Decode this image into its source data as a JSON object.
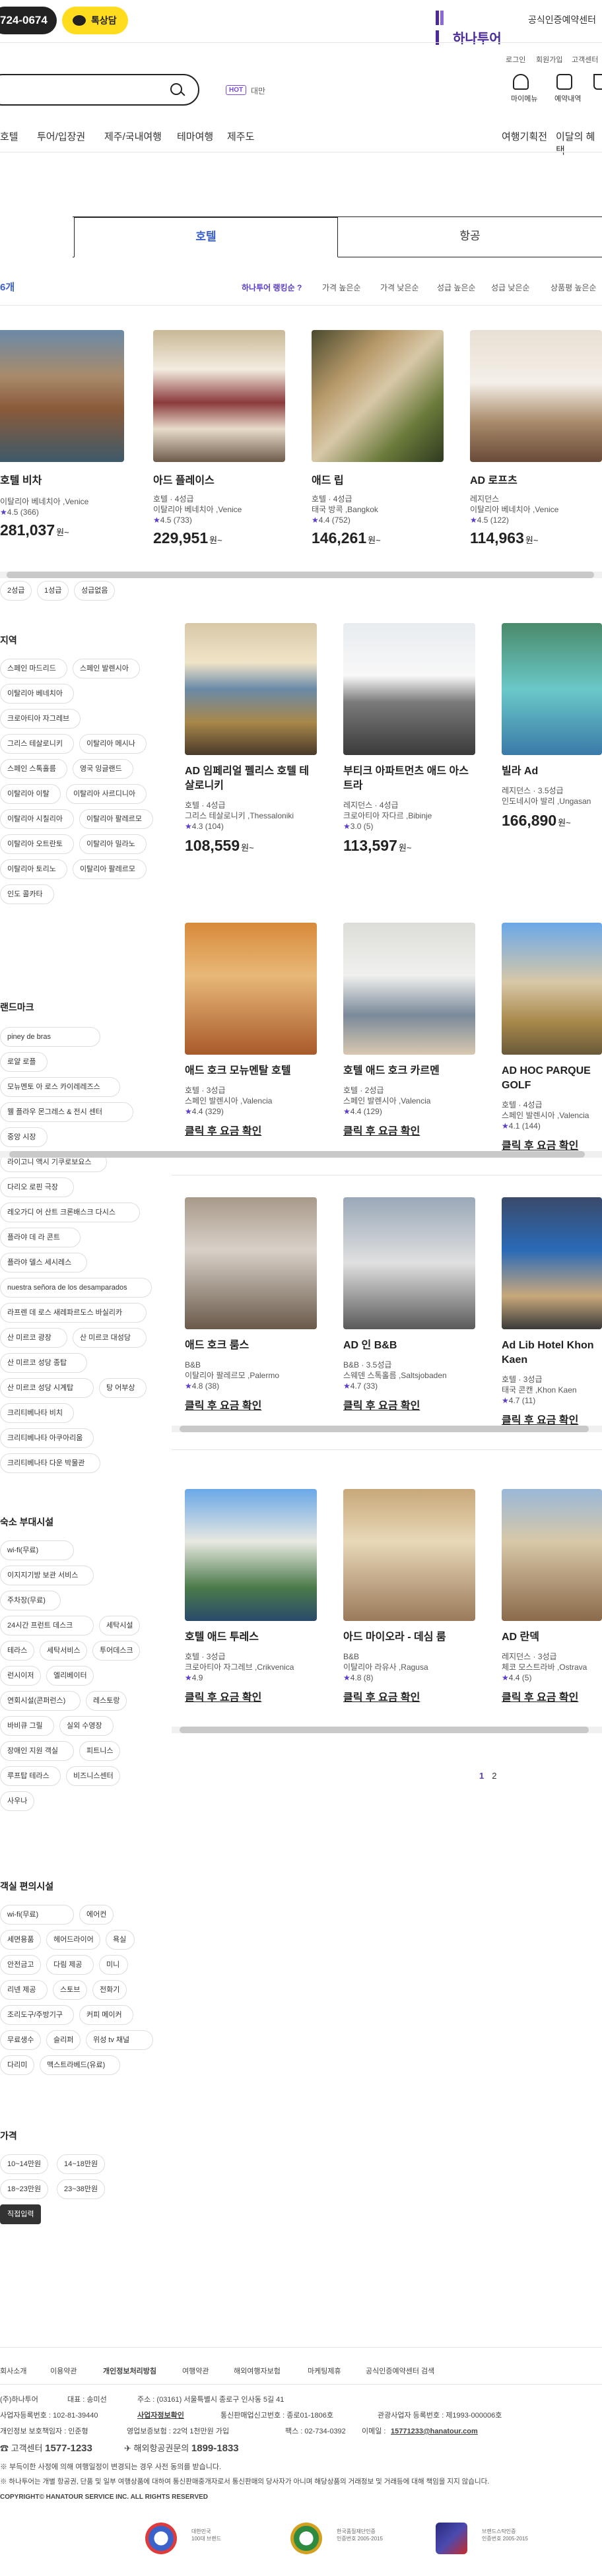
{
  "header": {
    "phone": "724-0674",
    "chat_label": "톡상담",
    "logo_text": "하나투어",
    "tagline": "공식인증예약센터",
    "util_links": [
      "로그인",
      "회원가입",
      "고객센터"
    ],
    "search_placeholder": "",
    "hot_badge": "HOT",
    "hot_keyword": "대만",
    "quick_icons": [
      "마이메뉴",
      "예약내역"
    ]
  },
  "nav": {
    "gnb": [
      "호텔",
      "투어/입장권",
      "제주/국내여행",
      "테마여행",
      "제주도"
    ],
    "gnb_right": [
      "여행기획전",
      "이달의 혜택"
    ]
  },
  "tabs": {
    "hotel": "호텔",
    "air": "항공"
  },
  "result": {
    "count": "6개",
    "sort": [
      "하나투어 랭킹순",
      "가격 높은순",
      "가격 낮은순",
      "성급 높은순",
      "성급 낮은순",
      "상품평 높은순"
    ],
    "sort_hint": "?"
  },
  "top_cards": [
    {
      "name": "호텔 비차",
      "grade": "",
      "location": "이탈리아 베네치아 ,Venice",
      "rating": "4.5",
      "reviews": "(366)",
      "price": "281,037",
      "unit": "원~"
    },
    {
      "name": "아드 플레이스",
      "grade": "호텔 · 4성급",
      "location": "이탈리아 베네치아 ,Venice",
      "rating": "4.5",
      "reviews": "(733)",
      "price": "229,951",
      "unit": "원~"
    },
    {
      "name": "애드 립",
      "grade": "호텔 · 4성급",
      "location": "태국 방콕 ,Bangkok",
      "rating": "4.4",
      "reviews": "(752)",
      "price": "146,261",
      "unit": "원~"
    },
    {
      "name": "AD 로프츠",
      "grade": "레지던스",
      "location": "이탈리아 베네치아 ,Venice",
      "rating": "4.5",
      "reviews": "(122)",
      "price": "114,963",
      "unit": "원~"
    }
  ],
  "top_chips": [
    "2성급",
    "1성급",
    "성급없음"
  ],
  "filters": {
    "region_title": "지역",
    "regions": [
      "스페인 마드리드",
      "스페인 발렌시아",
      "이탈리아 베네치아",
      "크로아티아 자그레브",
      "그리스 테살로니키",
      "이탈리아 메시나",
      "스페인 스톡홀름",
      "영국 잉글랜드",
      "이탈리아 이탈",
      "이탈리아 사르디니아",
      "이탈리아 시칠리아",
      "이탈리아 팔레르모",
      "이탈리아 오트란토",
      "이탈리아 밀라노",
      "이탈리아 토리노",
      "이탈리아 팔레르모",
      "인도 콜카타"
    ],
    "landmark_title": "랜드마크",
    "landmarks": [
      "piney de bras",
      "로얄 로플",
      "모뉴멘토 아 로스 카이레레즈스",
      "웰 플라우 몬그레스 & 전시 센터",
      "중앙 시장",
      "라이고니 액시 기쿠로보요스",
      "다리오 로핀 극장",
      "레오가디 어 산트 크론배스크 다시스",
      "플라야 데 라 콘트",
      "플라야 델스 세시레스",
      "nuestra señora de los desamparados",
      "라프렌 데 로스 새레파르도스 바실리카",
      "산 미르코 광장",
      "산 미르코 대성당",
      "산 미르코 성당 종탑",
      "산 미르코 성당 시계탑",
      "탕 어부상",
      "크리티베나타 비치",
      "크리티베나타 아쿠아리움",
      "크리티베나타 다운 박물관"
    ],
    "facility_title": "숙소 부대시설",
    "facilities": [
      "wi-fi(무료)",
      "이지지기방 보관 서비스",
      "주차장(무료)",
      "24시간 프런트 데스크",
      "세탁시설",
      "테라스",
      "세탁서비스",
      "투어데스크",
      "런시이저",
      "엘리베이터",
      "연회시설(콘퍼런스)",
      "레스토랑",
      "바비큐 그릴",
      "실외 수영장",
      "장애인 지원 객실",
      "피트니스",
      "루프탑 테라스",
      "비즈니스센터",
      "사우나"
    ],
    "room_title": "객실 편의시설",
    "rooms": [
      "wi-fi(무료)",
      "에어컨",
      "세면용품",
      "헤어드라이어",
      "욕실",
      "안전금고",
      "다림 제공",
      "미니",
      "리넨 제공",
      "스토브",
      "전화기",
      "조리도구/주방기구",
      "커피 메이커",
      "무료생수",
      "슬리퍼",
      "위성 tv 채널",
      "다리미",
      "맥스트라베드(유료)"
    ],
    "price_title": "가격",
    "prices": [
      "10~14만원",
      "14~18만원",
      "18~23만원",
      "23~38만원"
    ],
    "price_input": "직접입력"
  },
  "grid_cards": [
    {
      "name": "AD 임페리얼 펠리스 호텔 테살로니키",
      "grade": "호텔 · 4성급",
      "location": "그리스 테살로니키 ,Thessaloniki",
      "rating": "4.3",
      "reviews": "(104)",
      "price": "108,559",
      "unit": "원~"
    },
    {
      "name": "부티크 아파트먼츠 애드 아스트라",
      "grade": "레지던스 · 4성급",
      "location": "크로아티아 자다르 ,Bibinje",
      "rating": "3.0",
      "reviews": "(5)",
      "price": "113,597",
      "unit": "원~"
    },
    {
      "name": "빌라 Ad",
      "grade": "레지던스 · 3.5성급",
      "location": "인도네시아 발리 ,Ungasan",
      "rating": "",
      "reviews": "",
      "price": "166,890",
      "unit": "원~"
    },
    {
      "name": "애드 호크 모뉴멘탈 호텔",
      "grade": "호텔 · 3성급",
      "location": "스페인 발렌시아 ,Valencia",
      "rating": "4.4",
      "reviews": "(329)",
      "price": "클릭 후 요금 확인",
      "unit": ""
    },
    {
      "name": "호텔 애드 호크 카르멘",
      "grade": "호텔 · 2성급",
      "location": "스페인 발렌시아 ,Valencia",
      "rating": "4.4",
      "reviews": "(129)",
      "price": "클릭 후 요금 확인",
      "unit": ""
    },
    {
      "name": "AD HOC PARQUE GOLF",
      "grade": "호텔 · 4성급",
      "location": "스페인 발렌시아 ,Valencia",
      "rating": "4.1",
      "reviews": "(144)",
      "price": "클릭 후 요금 확인",
      "unit": ""
    },
    {
      "name": "애드 호크 룸스",
      "grade": "B&B",
      "location": "이탈리아 팔레르모 ,Palermo",
      "rating": "4.8",
      "reviews": "(38)",
      "price": "클릭 후 요금 확인",
      "unit": ""
    },
    {
      "name": "AD 인 B&B",
      "grade": "B&B · 3.5성급",
      "location": "스웨덴 스톡홀름 ,Saltsjobaden",
      "rating": "4.7",
      "reviews": "(33)",
      "price": "클릭 후 요금 확인",
      "unit": ""
    },
    {
      "name": "Ad Lib Hotel Khon Kaen",
      "grade": "호텔 · 3성급",
      "location": "태국 콘캔 ,Khon Kaen",
      "rating": "4.7",
      "reviews": "(11)",
      "price": "클릭 후 요금 확인",
      "unit": ""
    },
    {
      "name": "호텔 애드 투레스",
      "grade": "호텔 · 3성급",
      "location": "크로아티아 자그레브 ,Crikvenica",
      "rating": "4.9",
      "reviews": "",
      "price": "클릭 후 요금 확인",
      "unit": ""
    },
    {
      "name": "아드 마이오라 - 데심 룸",
      "grade": "B&B",
      "location": "이탈리아 라유사 ,Ragusa",
      "rating": "4.8",
      "reviews": "(8)",
      "price": "클릭 후 요금 확인",
      "unit": ""
    },
    {
      "name": "AD 란덱",
      "grade": "레지던스 · 3성급",
      "location": "체코 모스트라바 ,Ostrava",
      "rating": "4.4",
      "reviews": "(5)",
      "price": "클릭 후 요금 확인",
      "unit": ""
    }
  ],
  "pager": [
    "1",
    "2"
  ],
  "footer": {
    "links": [
      "회사소개",
      "이용약관",
      "개인정보처리방침",
      "여행약관",
      "해외여행자보험",
      "마케팅제휴",
      "공식인증예약센터 검색"
    ],
    "company": "(주)하나투어",
    "ceo": "대표 : 송미선",
    "address": "주소 : (03161) 서울특별시 종로구 인사동 5길 41",
    "biz_no": "사업자등록번호 : 102-81-39440",
    "biz_check": "사업자정보확인",
    "mail_order": "통신판매업신고번호 : 종로01-1806호",
    "tour_no": "관광사업자 등록번호 : 제1993-000006호",
    "privacy": "개인정보 보호책임자 : 인준형",
    "insurance": "영업보증보험 : 22억 1천만원 가입",
    "fax": "팩스 : 02-734-0392",
    "email_label": "이메일 :",
    "email": "15771233@hanatour.com",
    "cs_label": "고객센터",
    "cs_phone": "1577-1233",
    "overseas_label": "해외항공권문의",
    "overseas_phone": "1899-1833",
    "notice1": "※ 부득이한 사정에 의해 여행일정이 변경되는 경우 사전 동의를 받습니다.",
    "notice2": "※ 하나투어는 개별 항공권, 단품 및 일부 여행상품에 대하여 통신판매중개자로서 통신판매의 당사자가 아니며 해당상품의 거래정보 및 거래등에 대해 책임을 지지 않습니다.",
    "copyright": "COPYRIGHT© HANATOUR SERVICE INC. ALL RIGHTS RESERVED",
    "awards": [
      {
        "cap1": "대한민국",
        "cap2": "100대 브랜드"
      },
      {
        "cap1": "한국품질재단인증",
        "cap2": "인증번호 2005-2015"
      },
      {
        "cap1": "브랜드스탁인증",
        "cap2": "인증번호 2005-2015"
      }
    ]
  },
  "colors": {
    "accent": "#5a3ac9",
    "tab_blue": "#3b62c9",
    "chat_yellow": "#ffdc1e",
    "brand_purple": "#4a2a9c"
  }
}
